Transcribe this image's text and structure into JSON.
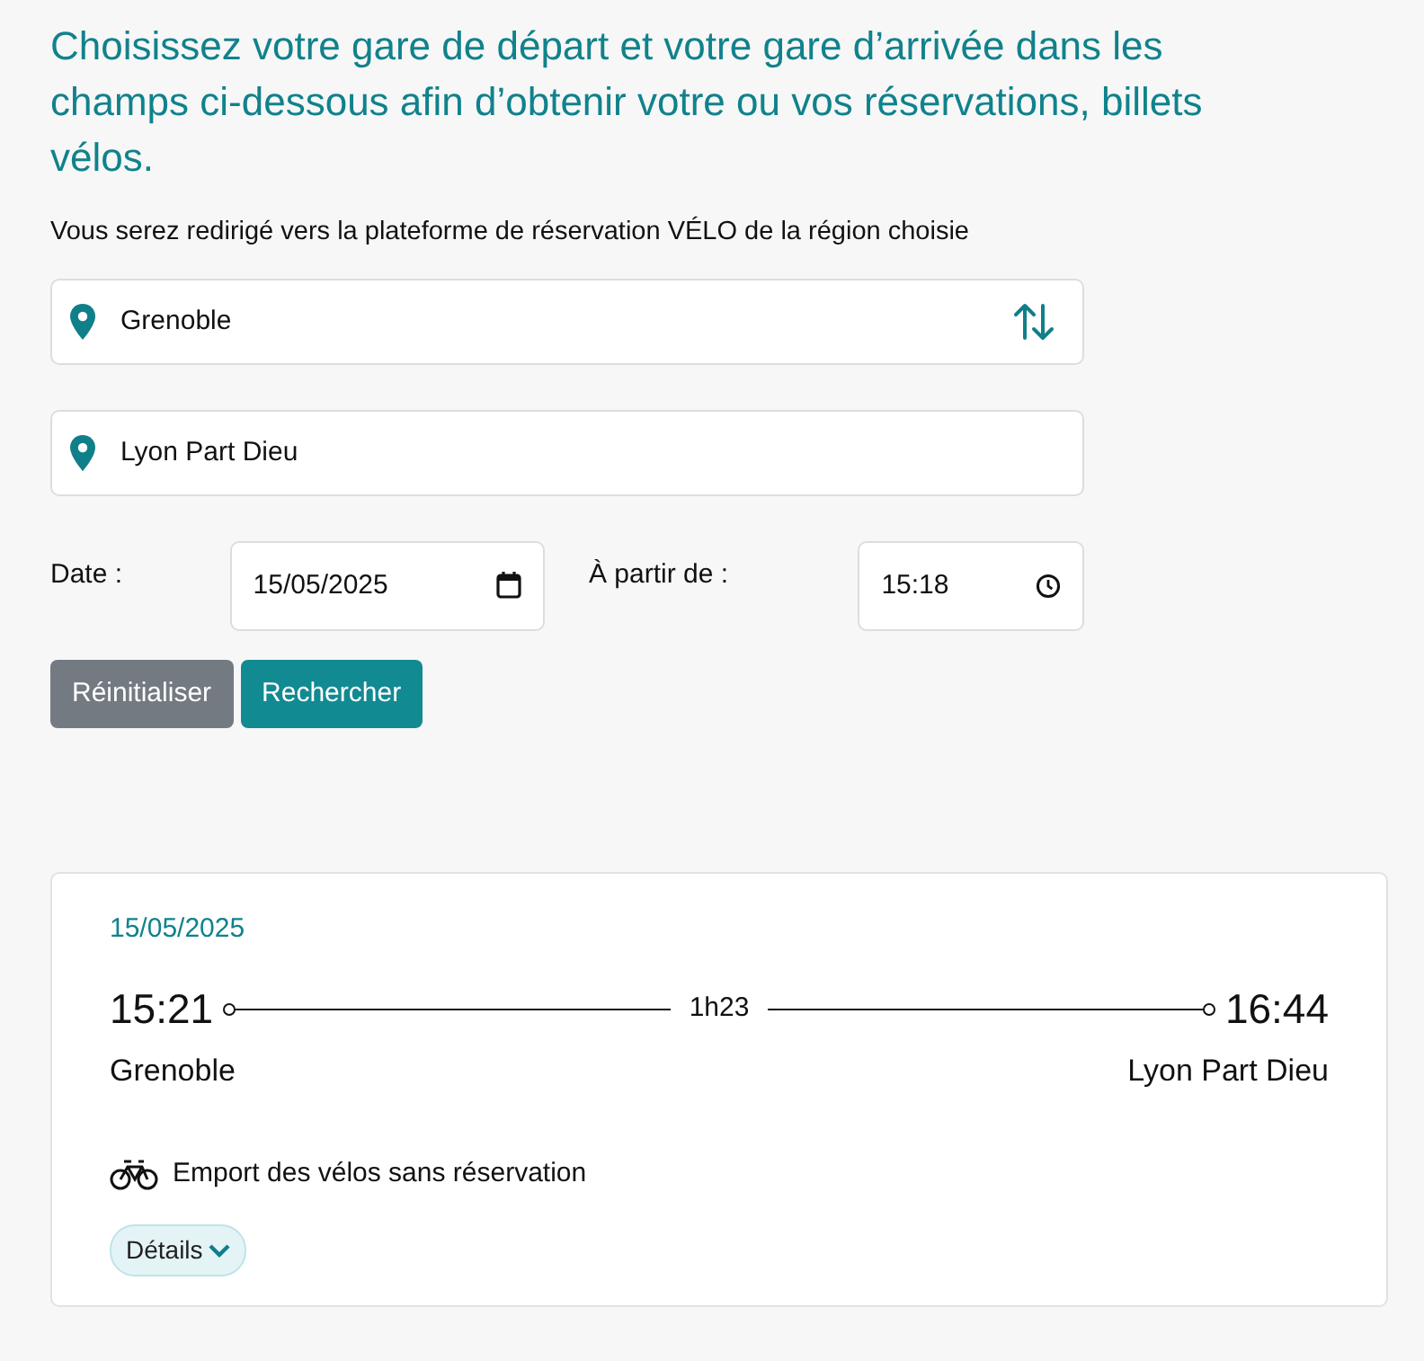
{
  "heading": "Choisissez votre gare de départ et votre gare d’arrivée dans les champs ci-dessous afin d’obtenir votre ou vos réservations, billets vélos.",
  "notice": "Vous serez redirigé vers la plateforme de réservation VÉLO de la région choisie",
  "departure": {
    "value": "Grenoble"
  },
  "arrival": {
    "value": "Lyon Part Dieu"
  },
  "date": {
    "label": "Date :",
    "value": "15/05/2025"
  },
  "time": {
    "label": "À partir de :",
    "value": "15:18"
  },
  "buttons": [
    {
      "label": "Réinitialiser",
      "kind": "secondary"
    },
    {
      "label": "Rechercher",
      "kind": "primary"
    }
  ],
  "result": {
    "date": "15/05/2025",
    "departure_time": "15:21",
    "duration": "1h23",
    "arrival_time": "16:44",
    "departure_station": "Grenoble",
    "arrival_station": "Lyon Part Dieu",
    "bike_info": "Emport des vélos sans réservation",
    "details": {
      "label": "Détails",
      "expanded": false
    }
  }
}
